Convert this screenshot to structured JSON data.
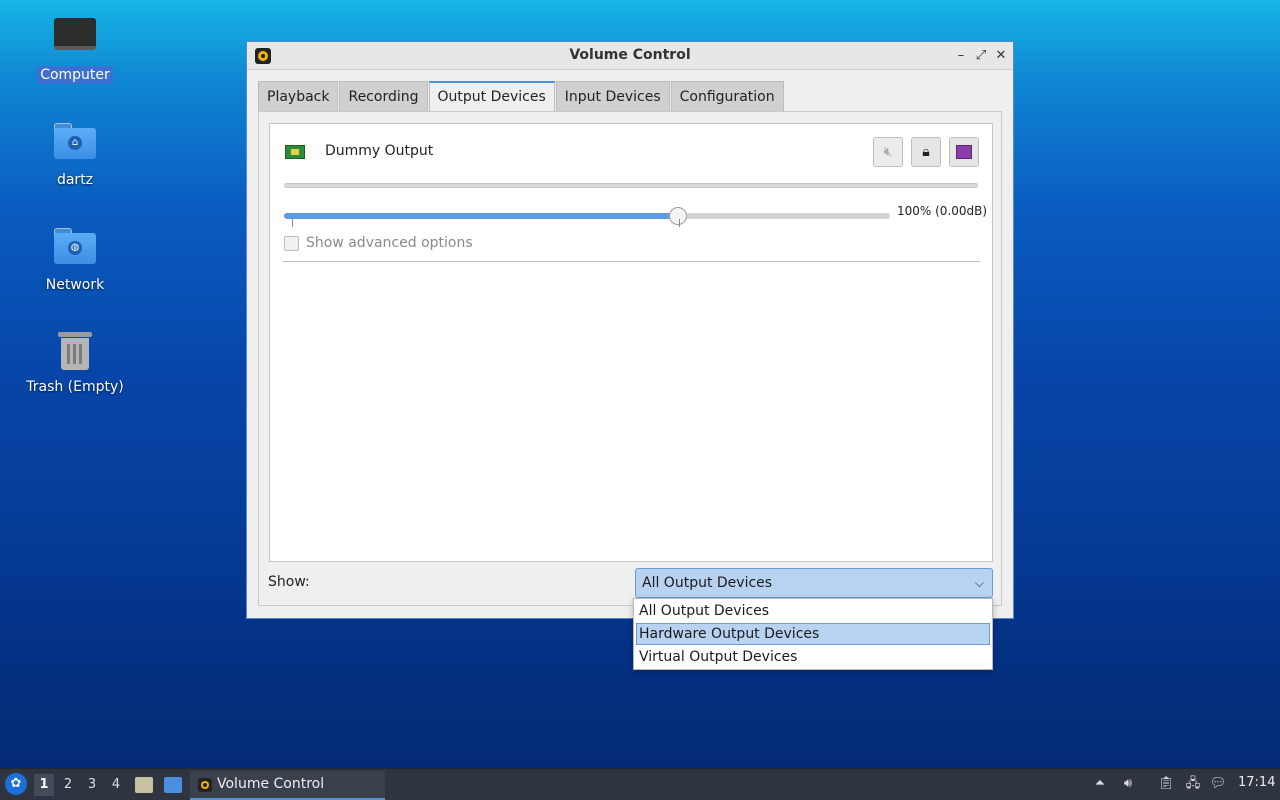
{
  "desktop": {
    "icons": [
      {
        "label": "Computer",
        "icon": "computer-icon"
      },
      {
        "label": "dartz",
        "icon": "home-folder-icon"
      },
      {
        "label": "Network",
        "icon": "network-folder-icon"
      },
      {
        "label": "Trash (Empty)",
        "icon": "trash-icon"
      }
    ]
  },
  "window": {
    "title": "Volume Control",
    "controls": {
      "minimize": "–",
      "maximize": "⤢",
      "close": "✕"
    },
    "tabs": [
      {
        "label": "Playback"
      },
      {
        "label": "Recording"
      },
      {
        "label": "Output Devices",
        "active": true
      },
      {
        "label": "Input Devices"
      },
      {
        "label": "Configuration"
      }
    ],
    "device": {
      "name": "Dummy Output",
      "volume_text": "100% (0.00dB)",
      "volume_fraction": 0.65,
      "advanced_label": "Show advanced options",
      "advanced_checked": false,
      "buttons": [
        "mute-icon",
        "lock-icon",
        "set-default-icon"
      ]
    },
    "show": {
      "label": "Show:",
      "selected": "All Output Devices",
      "options": [
        "All Output Devices",
        "Hardware Output Devices",
        "Virtual Output Devices"
      ],
      "highlighted_index": 1
    }
  },
  "taskbar": {
    "workspaces": [
      "1",
      "2",
      "3",
      "4"
    ],
    "active_workspace": "1",
    "task_label": "Volume Control",
    "clock": "17:14"
  },
  "colors": {
    "accent": "#4a90d9",
    "selection": "#b8d2f1",
    "taskbar": "#2f3540"
  }
}
